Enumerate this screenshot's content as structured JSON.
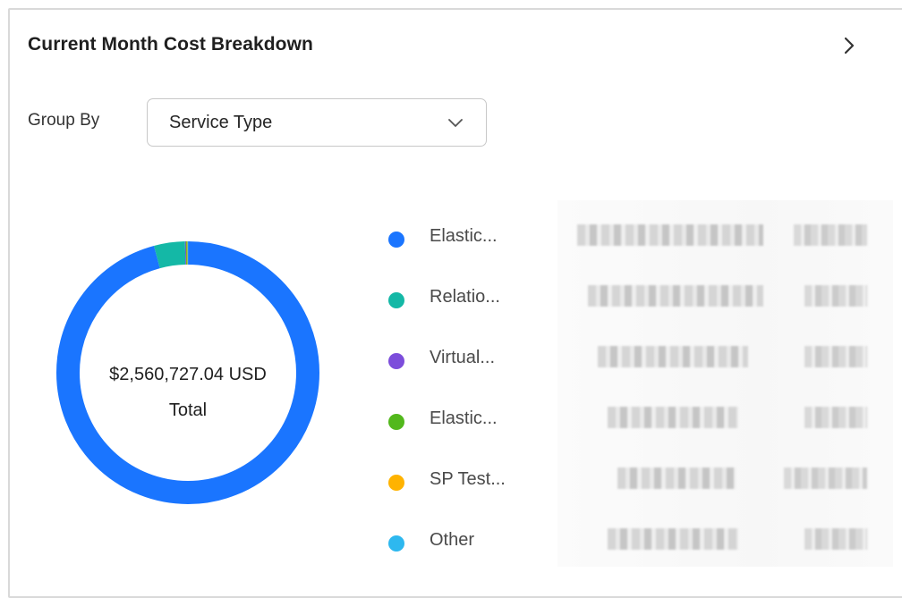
{
  "card": {
    "title": "Current Month Cost Breakdown"
  },
  "group_by": {
    "label": "Group By",
    "selected": "Service Type"
  },
  "summary": {
    "total_amount": "$2,560,727.04 USD",
    "total_label": "Total"
  },
  "legend": [
    {
      "label": "Elastic...",
      "color": "#1a75ff"
    },
    {
      "label": "Relatio...",
      "color": "#14b8a6"
    },
    {
      "label": "Virtual...",
      "color": "#7c4ddb"
    },
    {
      "label": "Elastic...",
      "color": "#52b81c"
    },
    {
      "label": "SP Test...",
      "color": "#ffb300"
    },
    {
      "label": "Other",
      "color": "#2eb8ef"
    }
  ],
  "donut_shares": [
    {
      "share": 0.958,
      "color": "#1a75ff"
    },
    {
      "share": 0.038,
      "color": "#14b8a6"
    },
    {
      "share": 0.001,
      "color": "#7c4ddb"
    },
    {
      "share": 0.001,
      "color": "#52b81c"
    },
    {
      "share": 0.001,
      "color": "#ffb300"
    },
    {
      "share": 0.001,
      "color": "#2eb8ef"
    }
  ],
  "icons": {
    "detail": "chevron-right-icon",
    "dropdown": "chevron-down-icon"
  }
}
